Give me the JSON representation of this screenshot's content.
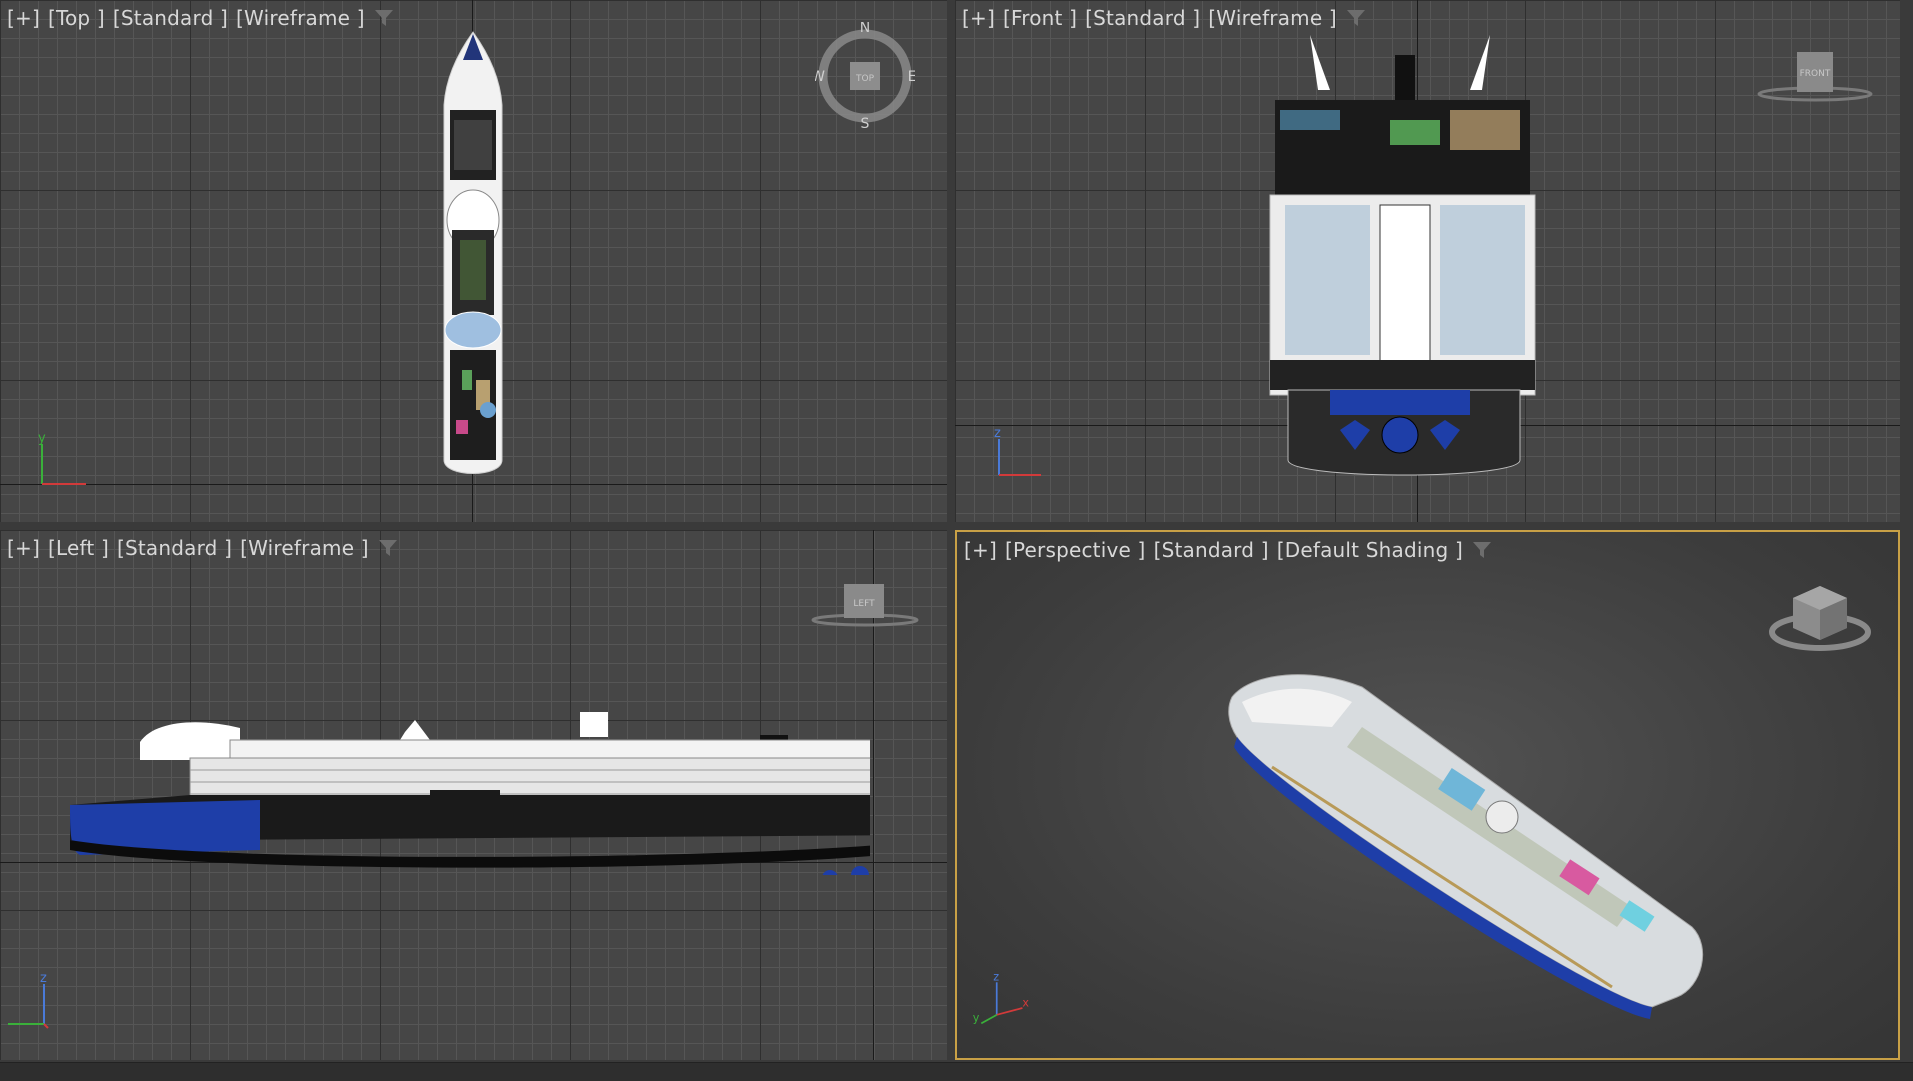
{
  "viewports": {
    "top": {
      "plus": "[+]",
      "view": "[Top ]",
      "standard": "[Standard ]",
      "shading": "[Wireframe ]",
      "compass": {
        "n": "N",
        "s": "S",
        "e": "E",
        "w": "W",
        "cube": "TOP"
      },
      "axes": {
        "up": "y",
        "right": "x"
      }
    },
    "front": {
      "plus": "[+]",
      "view": "[Front ]",
      "standard": "[Standard ]",
      "shading": "[Wireframe ]",
      "cube": "FRONT",
      "axes": {
        "up": "z",
        "right": "x"
      }
    },
    "left": {
      "plus": "[+]",
      "view": "[Left ]",
      "standard": "[Standard ]",
      "shading": "[Wireframe ]",
      "cube": "LEFT",
      "axes": {
        "up": "z",
        "right": "y"
      }
    },
    "perspective": {
      "plus": "[+]",
      "view": "[Perspective ]",
      "standard": "[Standard ]",
      "shading": "[Default Shading ]",
      "axes": {
        "up": "z",
        "x": "x",
        "y": "y"
      }
    }
  },
  "colors": {
    "active_border": "#c8a046",
    "x_axis": "#d23a3a",
    "y_axis": "#3ab03a",
    "z_axis": "#4a7ad8",
    "hull_blue": "#1e3ea8"
  },
  "icons": [
    "filter-icon",
    "compass-icon",
    "view-cube-icon",
    "axis-gizmo-icon"
  ]
}
